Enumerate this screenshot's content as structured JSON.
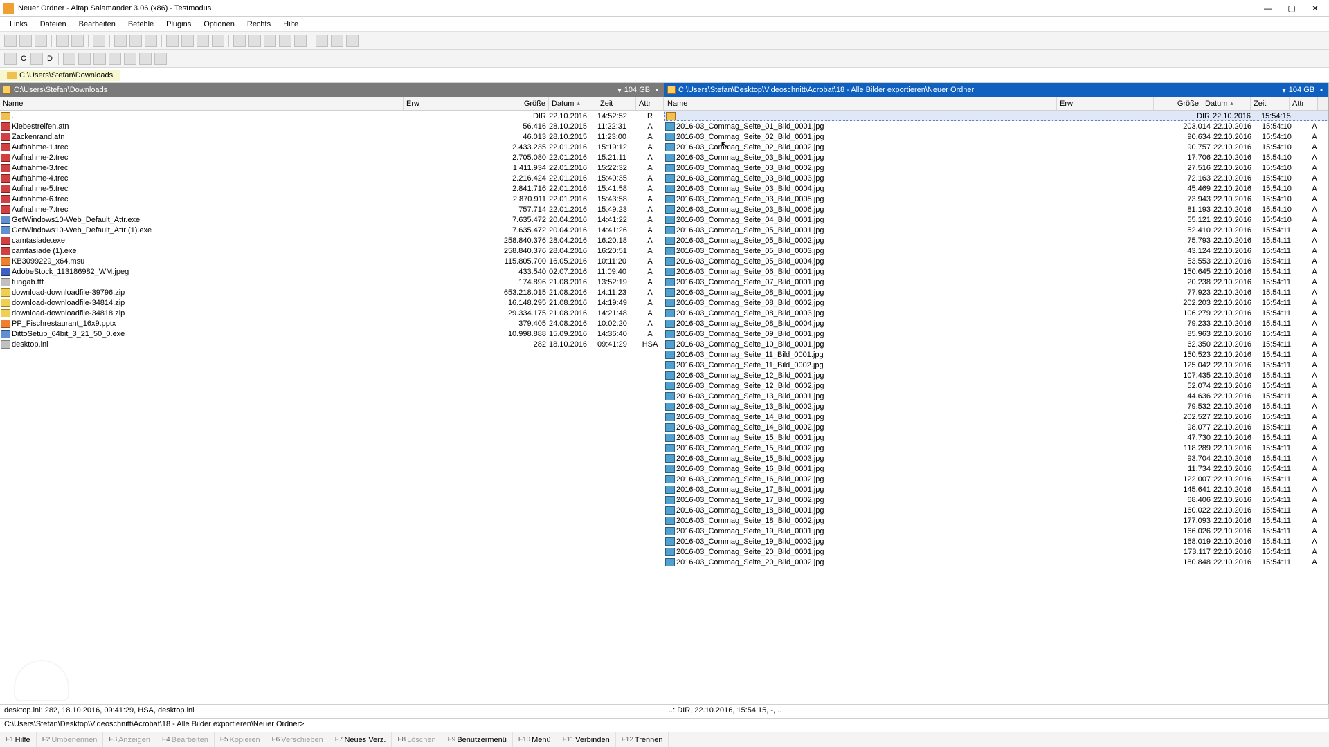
{
  "window": {
    "title": "Neuer Ordner - Altap Salamander 3.06 (x86) - Testmodus"
  },
  "menu": [
    "Links",
    "Dateien",
    "Bearbeiten",
    "Befehle",
    "Plugins",
    "Optionen",
    "Rechts",
    "Hilfe"
  ],
  "drives": [
    "C",
    "D"
  ],
  "tabbar": {
    "tab0": "C:\\Users\\Stefan\\Downloads"
  },
  "left": {
    "path": "C:\\Users\\Stefan\\Downloads",
    "free": "104 GB",
    "headers": {
      "name": "Name",
      "ext": "Erw",
      "size": "Größe",
      "date": "Datum",
      "time": "Zeit",
      "attr": "Attr"
    },
    "rows": [
      {
        "icon": "folder",
        "name": "..",
        "size": "DIR",
        "date": "22.10.2016",
        "time": "14:52:52",
        "attr": "R"
      },
      {
        "icon": "red",
        "name": "Klebestreifen.atn",
        "size": "56.416",
        "date": "28.10.2015",
        "time": "11:22:31",
        "attr": "A"
      },
      {
        "icon": "red",
        "name": "Zackenrand.atn",
        "size": "46.013",
        "date": "28.10.2015",
        "time": "11:23:00",
        "attr": "A"
      },
      {
        "icon": "red",
        "name": "Aufnahme-1.trec",
        "size": "2.433.235",
        "date": "22.01.2016",
        "time": "15:19:12",
        "attr": "A"
      },
      {
        "icon": "red",
        "name": "Aufnahme-2.trec",
        "size": "2.705.080",
        "date": "22.01.2016",
        "time": "15:21:11",
        "attr": "A"
      },
      {
        "icon": "red",
        "name": "Aufnahme-3.trec",
        "size": "1.411.934",
        "date": "22.01.2016",
        "time": "15:22:32",
        "attr": "A"
      },
      {
        "icon": "red",
        "name": "Aufnahme-4.trec",
        "size": "2.216.424",
        "date": "22.01.2016",
        "time": "15:40:35",
        "attr": "A"
      },
      {
        "icon": "red",
        "name": "Aufnahme-5.trec",
        "size": "2.841.716",
        "date": "22.01.2016",
        "time": "15:41:58",
        "attr": "A"
      },
      {
        "icon": "red",
        "name": "Aufnahme-6.trec",
        "size": "2.870.911",
        "date": "22.01.2016",
        "time": "15:43:58",
        "attr": "A"
      },
      {
        "icon": "red",
        "name": "Aufnahme-7.trec",
        "size": "757.714",
        "date": "22.01.2016",
        "time": "15:49:23",
        "attr": "A"
      },
      {
        "icon": "app",
        "name": "GetWindows10-Web_Default_Attr.exe",
        "size": "7.635.472",
        "date": "20.04.2016",
        "time": "14:41:22",
        "attr": "A"
      },
      {
        "icon": "app",
        "name": "GetWindows10-Web_Default_Attr (1).exe",
        "size": "7.635.472",
        "date": "20.04.2016",
        "time": "14:41:26",
        "attr": "A"
      },
      {
        "icon": "red",
        "name": "camtasiade.exe",
        "size": "258.840.376",
        "date": "28.04.2016",
        "time": "16:20:18",
        "attr": "A"
      },
      {
        "icon": "red",
        "name": "camtasiade (1).exe",
        "size": "258.840.376",
        "date": "28.04.2016",
        "time": "16:20:51",
        "attr": "A"
      },
      {
        "icon": "orange",
        "name": "KB3099229_x64.msu",
        "size": "115.805.700",
        "date": "16.05.2016",
        "time": "10:11:20",
        "attr": "A"
      },
      {
        "icon": "blue",
        "name": "AdobeStock_113186982_WM.jpeg",
        "size": "433.540",
        "date": "02.07.2016",
        "time": "11:09:40",
        "attr": "A"
      },
      {
        "icon": "gray",
        "name": "tungab.ttf",
        "size": "174.896",
        "date": "21.08.2016",
        "time": "13:52:19",
        "attr": "A"
      },
      {
        "icon": "zip",
        "name": "download-downloadfile-39796.zip",
        "size": "653.218.015",
        "date": "21.08.2016",
        "time": "14:11:23",
        "attr": "A"
      },
      {
        "icon": "zip",
        "name": "download-downloadfile-34814.zip",
        "size": "16.148.295",
        "date": "21.08.2016",
        "time": "14:19:49",
        "attr": "A"
      },
      {
        "icon": "zip",
        "name": "download-downloadfile-34818.zip",
        "size": "29.334.175",
        "date": "21.08.2016",
        "time": "14:21:48",
        "attr": "A"
      },
      {
        "icon": "orange",
        "name": "PP_Fischrestaurant_16x9.pptx",
        "size": "379.405",
        "date": "24.08.2016",
        "time": "10:02:20",
        "attr": "A"
      },
      {
        "icon": "app",
        "name": "DittoSetup_64bit_3_21_50_0.exe",
        "size": "10.998.888",
        "date": "15.09.2016",
        "time": "14:36:40",
        "attr": "A"
      },
      {
        "icon": "gray",
        "name": "desktop.ini",
        "size": "282",
        "date": "18.10.2016",
        "time": "09:41:29",
        "attr": "HSA"
      }
    ]
  },
  "right": {
    "path": "C:\\Users\\Stefan\\Desktop\\Videoschnitt\\Acrobat\\18 - Alle Bilder exportieren\\Neuer Ordner",
    "free": "104 GB",
    "headers": {
      "name": "Name",
      "ext": "Erw",
      "size": "Größe",
      "date": "Datum",
      "time": "Zeit",
      "attr": "Attr"
    },
    "rows": [
      {
        "icon": "folder",
        "name": "..",
        "size": "DIR",
        "date": "22.10.2016",
        "time": "15:54:15",
        "attr": "",
        "sel": true
      },
      {
        "icon": "img",
        "name": "2016-03_Commag_Seite_01_Bild_0001.jpg",
        "size": "203.014",
        "date": "22.10.2016",
        "time": "15:54:10",
        "attr": "A"
      },
      {
        "icon": "img",
        "name": "2016-03_Commag_Seite_02_Bild_0001.jpg",
        "size": "90.634",
        "date": "22.10.2016",
        "time": "15:54:10",
        "attr": "A"
      },
      {
        "icon": "img",
        "name": "2016-03_Commag_Seite_02_Bild_0002.jpg",
        "size": "90.757",
        "date": "22.10.2016",
        "time": "15:54:10",
        "attr": "A"
      },
      {
        "icon": "img",
        "name": "2016-03_Commag_Seite_03_Bild_0001.jpg",
        "size": "17.706",
        "date": "22.10.2016",
        "time": "15:54:10",
        "attr": "A"
      },
      {
        "icon": "img",
        "name": "2016-03_Commag_Seite_03_Bild_0002.jpg",
        "size": "27.516",
        "date": "22.10.2016",
        "time": "15:54:10",
        "attr": "A"
      },
      {
        "icon": "img",
        "name": "2016-03_Commag_Seite_03_Bild_0003.jpg",
        "size": "72.163",
        "date": "22.10.2016",
        "time": "15:54:10",
        "attr": "A"
      },
      {
        "icon": "img",
        "name": "2016-03_Commag_Seite_03_Bild_0004.jpg",
        "size": "45.469",
        "date": "22.10.2016",
        "time": "15:54:10",
        "attr": "A"
      },
      {
        "icon": "img",
        "name": "2016-03_Commag_Seite_03_Bild_0005.jpg",
        "size": "73.943",
        "date": "22.10.2016",
        "time": "15:54:10",
        "attr": "A"
      },
      {
        "icon": "img",
        "name": "2016-03_Commag_Seite_03_Bild_0006.jpg",
        "size": "81.193",
        "date": "22.10.2016",
        "time": "15:54:10",
        "attr": "A"
      },
      {
        "icon": "img",
        "name": "2016-03_Commag_Seite_04_Bild_0001.jpg",
        "size": "55.121",
        "date": "22.10.2016",
        "time": "15:54:10",
        "attr": "A"
      },
      {
        "icon": "img",
        "name": "2016-03_Commag_Seite_05_Bild_0001.jpg",
        "size": "52.410",
        "date": "22.10.2016",
        "time": "15:54:11",
        "attr": "A"
      },
      {
        "icon": "img",
        "name": "2016-03_Commag_Seite_05_Bild_0002.jpg",
        "size": "75.793",
        "date": "22.10.2016",
        "time": "15:54:11",
        "attr": "A"
      },
      {
        "icon": "img",
        "name": "2016-03_Commag_Seite_05_Bild_0003.jpg",
        "size": "43.124",
        "date": "22.10.2016",
        "time": "15:54:11",
        "attr": "A"
      },
      {
        "icon": "img",
        "name": "2016-03_Commag_Seite_05_Bild_0004.jpg",
        "size": "53.553",
        "date": "22.10.2016",
        "time": "15:54:11",
        "attr": "A"
      },
      {
        "icon": "img",
        "name": "2016-03_Commag_Seite_06_Bild_0001.jpg",
        "size": "150.645",
        "date": "22.10.2016",
        "time": "15:54:11",
        "attr": "A"
      },
      {
        "icon": "img",
        "name": "2016-03_Commag_Seite_07_Bild_0001.jpg",
        "size": "20.238",
        "date": "22.10.2016",
        "time": "15:54:11",
        "attr": "A"
      },
      {
        "icon": "img",
        "name": "2016-03_Commag_Seite_08_Bild_0001.jpg",
        "size": "77.923",
        "date": "22.10.2016",
        "time": "15:54:11",
        "attr": "A"
      },
      {
        "icon": "img",
        "name": "2016-03_Commag_Seite_08_Bild_0002.jpg",
        "size": "202.203",
        "date": "22.10.2016",
        "time": "15:54:11",
        "attr": "A"
      },
      {
        "icon": "img",
        "name": "2016-03_Commag_Seite_08_Bild_0003.jpg",
        "size": "106.279",
        "date": "22.10.2016",
        "time": "15:54:11",
        "attr": "A"
      },
      {
        "icon": "img",
        "name": "2016-03_Commag_Seite_08_Bild_0004.jpg",
        "size": "79.233",
        "date": "22.10.2016",
        "time": "15:54:11",
        "attr": "A"
      },
      {
        "icon": "img",
        "name": "2016-03_Commag_Seite_09_Bild_0001.jpg",
        "size": "85.963",
        "date": "22.10.2016",
        "time": "15:54:11",
        "attr": "A"
      },
      {
        "icon": "img",
        "name": "2016-03_Commag_Seite_10_Bild_0001.jpg",
        "size": "62.350",
        "date": "22.10.2016",
        "time": "15:54:11",
        "attr": "A"
      },
      {
        "icon": "img",
        "name": "2016-03_Commag_Seite_11_Bild_0001.jpg",
        "size": "150.523",
        "date": "22.10.2016",
        "time": "15:54:11",
        "attr": "A"
      },
      {
        "icon": "img",
        "name": "2016-03_Commag_Seite_11_Bild_0002.jpg",
        "size": "125.042",
        "date": "22.10.2016",
        "time": "15:54:11",
        "attr": "A"
      },
      {
        "icon": "img",
        "name": "2016-03_Commag_Seite_12_Bild_0001.jpg",
        "size": "107.435",
        "date": "22.10.2016",
        "time": "15:54:11",
        "attr": "A"
      },
      {
        "icon": "img",
        "name": "2016-03_Commag_Seite_12_Bild_0002.jpg",
        "size": "52.074",
        "date": "22.10.2016",
        "time": "15:54:11",
        "attr": "A"
      },
      {
        "icon": "img",
        "name": "2016-03_Commag_Seite_13_Bild_0001.jpg",
        "size": "44.636",
        "date": "22.10.2016",
        "time": "15:54:11",
        "attr": "A"
      },
      {
        "icon": "img",
        "name": "2016-03_Commag_Seite_13_Bild_0002.jpg",
        "size": "79.532",
        "date": "22.10.2016",
        "time": "15:54:11",
        "attr": "A"
      },
      {
        "icon": "img",
        "name": "2016-03_Commag_Seite_14_Bild_0001.jpg",
        "size": "202.527",
        "date": "22.10.2016",
        "time": "15:54:11",
        "attr": "A"
      },
      {
        "icon": "img",
        "name": "2016-03_Commag_Seite_14_Bild_0002.jpg",
        "size": "98.077",
        "date": "22.10.2016",
        "time": "15:54:11",
        "attr": "A"
      },
      {
        "icon": "img",
        "name": "2016-03_Commag_Seite_15_Bild_0001.jpg",
        "size": "47.730",
        "date": "22.10.2016",
        "time": "15:54:11",
        "attr": "A"
      },
      {
        "icon": "img",
        "name": "2016-03_Commag_Seite_15_Bild_0002.jpg",
        "size": "118.289",
        "date": "22.10.2016",
        "time": "15:54:11",
        "attr": "A"
      },
      {
        "icon": "img",
        "name": "2016-03_Commag_Seite_15_Bild_0003.jpg",
        "size": "93.704",
        "date": "22.10.2016",
        "time": "15:54:11",
        "attr": "A"
      },
      {
        "icon": "img",
        "name": "2016-03_Commag_Seite_16_Bild_0001.jpg",
        "size": "11.734",
        "date": "22.10.2016",
        "time": "15:54:11",
        "attr": "A"
      },
      {
        "icon": "img",
        "name": "2016-03_Commag_Seite_16_Bild_0002.jpg",
        "size": "122.007",
        "date": "22.10.2016",
        "time": "15:54:11",
        "attr": "A"
      },
      {
        "icon": "img",
        "name": "2016-03_Commag_Seite_17_Bild_0001.jpg",
        "size": "145.641",
        "date": "22.10.2016",
        "time": "15:54:11",
        "attr": "A"
      },
      {
        "icon": "img",
        "name": "2016-03_Commag_Seite_17_Bild_0002.jpg",
        "size": "68.406",
        "date": "22.10.2016",
        "time": "15:54:11",
        "attr": "A"
      },
      {
        "icon": "img",
        "name": "2016-03_Commag_Seite_18_Bild_0001.jpg",
        "size": "160.022",
        "date": "22.10.2016",
        "time": "15:54:11",
        "attr": "A"
      },
      {
        "icon": "img",
        "name": "2016-03_Commag_Seite_18_Bild_0002.jpg",
        "size": "177.093",
        "date": "22.10.2016",
        "time": "15:54:11",
        "attr": "A"
      },
      {
        "icon": "img",
        "name": "2016-03_Commag_Seite_19_Bild_0001.jpg",
        "size": "166.026",
        "date": "22.10.2016",
        "time": "15:54:11",
        "attr": "A"
      },
      {
        "icon": "img",
        "name": "2016-03_Commag_Seite_19_Bild_0002.jpg",
        "size": "168.019",
        "date": "22.10.2016",
        "time": "15:54:11",
        "attr": "A"
      },
      {
        "icon": "img",
        "name": "2016-03_Commag_Seite_20_Bild_0001.jpg",
        "size": "173.117",
        "date": "22.10.2016",
        "time": "15:54:11",
        "attr": "A"
      },
      {
        "icon": "img",
        "name": "2016-03_Commag_Seite_20_Bild_0002.jpg",
        "size": "180.848",
        "date": "22.10.2016",
        "time": "15:54:11",
        "attr": "A"
      }
    ]
  },
  "info": {
    "left": "desktop.ini: 282, 18.10.2016, 09:41:29, HSA, desktop.ini",
    "right": "..: DIR, 22.10.2016, 15:54:15, -, .."
  },
  "cmdline": "C:\\Users\\Stefan\\Desktop\\Videoschnitt\\Acrobat\\18 - Alle Bilder exportieren\\Neuer Ordner>",
  "fkeys": [
    {
      "k": "F1",
      "l": "Hilfe",
      "dim": false
    },
    {
      "k": "F2",
      "l": "Umbenennen",
      "dim": true
    },
    {
      "k": "F3",
      "l": "Anzeigen",
      "dim": true
    },
    {
      "k": "F4",
      "l": "Bearbeiten",
      "dim": true
    },
    {
      "k": "F5",
      "l": "Kopieren",
      "dim": true
    },
    {
      "k": "F6",
      "l": "Verschieben",
      "dim": true
    },
    {
      "k": "F7",
      "l": "Neues Verz.",
      "dim": false
    },
    {
      "k": "F8",
      "l": "Löschen",
      "dim": true
    },
    {
      "k": "F9",
      "l": "Benutzermenü",
      "dim": false
    },
    {
      "k": "F10",
      "l": "Menü",
      "dim": false
    },
    {
      "k": "F11",
      "l": "Verbinden",
      "dim": false
    },
    {
      "k": "F12",
      "l": "Trennen",
      "dim": false
    }
  ]
}
